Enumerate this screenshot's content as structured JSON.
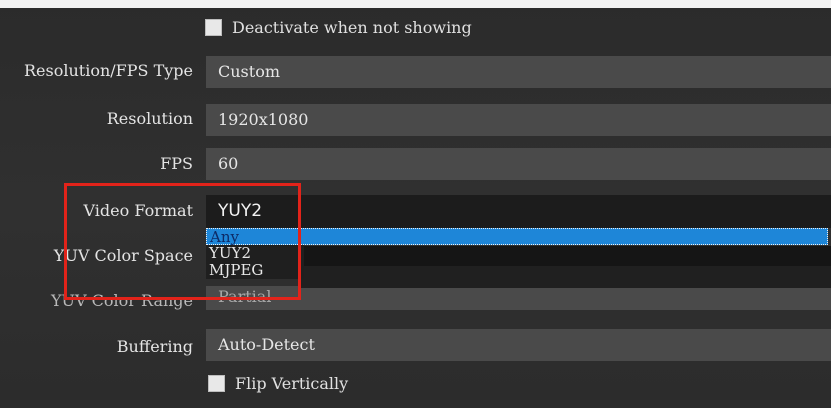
{
  "checkboxes": {
    "deactivate_label": "Deactivate when not showing",
    "flip_label": "Flip Vertically"
  },
  "rows": {
    "res_fps_type": {
      "label": "Resolution/FPS Type",
      "value": "Custom"
    },
    "resolution": {
      "label": "Resolution",
      "value": "1920x1080"
    },
    "fps": {
      "label": "FPS",
      "value": "60"
    },
    "video_format": {
      "label": "Video Format",
      "value": "YUY2"
    },
    "yuv_color_space": {
      "label": "YUV Color Space"
    },
    "yuv_color_range": {
      "label": "YUV Color Range",
      "value": "Partial"
    },
    "buffering": {
      "label": "Buffering",
      "value": "Auto-Detect"
    }
  },
  "dropdown": {
    "options": [
      "Any",
      "YUY2",
      "MJPEG"
    ],
    "highlighted": "Any"
  },
  "colors": {
    "selection": "#1e86d8",
    "annotation_box": "#e2231a"
  }
}
